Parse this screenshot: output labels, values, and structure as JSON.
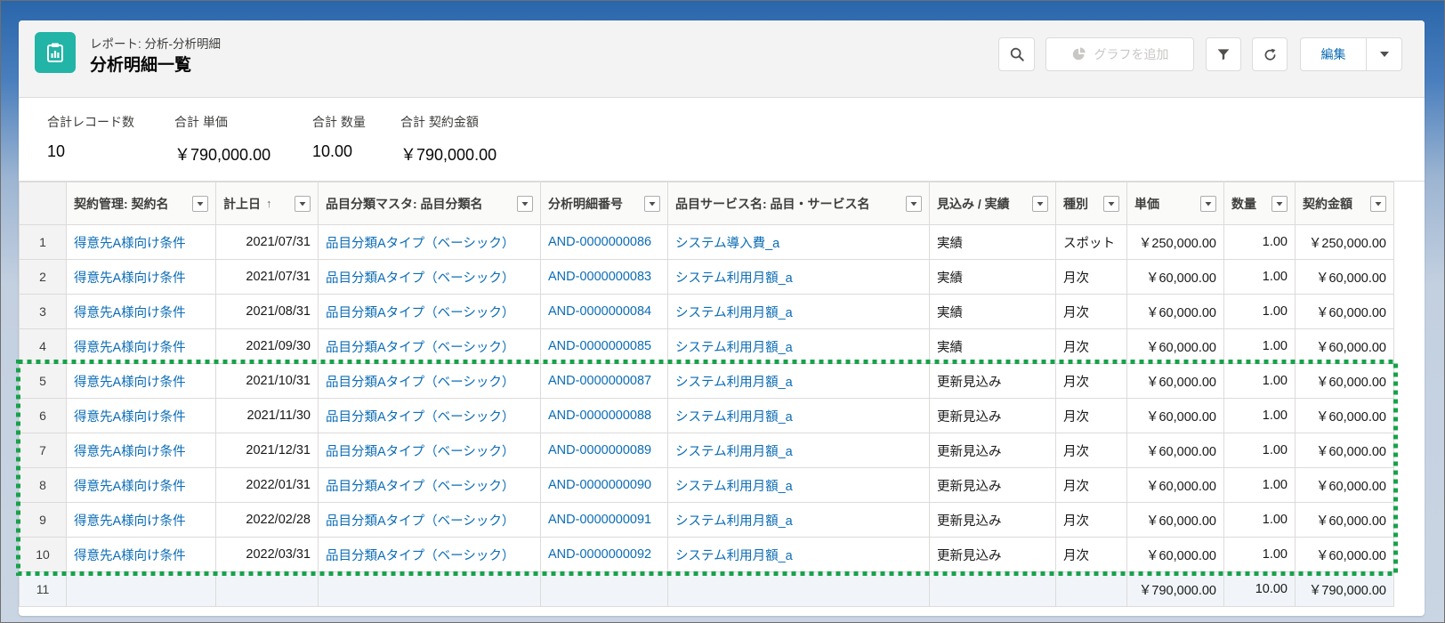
{
  "colors": {
    "accent": "#22b4a6",
    "link": "#0b6cb5",
    "highlight": "#17a24a",
    "page_background": "#2a66ab"
  },
  "report": {
    "icon": "report-icon",
    "subtitle": "レポート: 分析-分析明細",
    "title": "分析明細一覧"
  },
  "toolbar": {
    "search_icon": "search-icon",
    "add_chart_icon": "pie-chart-icon",
    "add_chart_label": "グラフを追加",
    "filter_icon": "filter-icon",
    "refresh_icon": "refresh-icon",
    "edit_label": "編集",
    "edit_menu_icon": "chevron-down-icon"
  },
  "summary": [
    {
      "label": "合計レコード数",
      "value": "10"
    },
    {
      "label": "合計 単価",
      "value": "￥790,000.00"
    },
    {
      "label": "合計 数量",
      "value": "10.00"
    },
    {
      "label": "合計 契約金額",
      "value": "￥790,000.00"
    }
  ],
  "table": {
    "columns": [
      {
        "label": "契約管理: 契約名"
      },
      {
        "label": "計上日",
        "sort": "↑"
      },
      {
        "label": "品目分類マスタ: 品目分類名"
      },
      {
        "label": "分析明細番号"
      },
      {
        "label": "品目サービス名: 品目・サービス名"
      },
      {
        "label": "見込み / 実績"
      },
      {
        "label": "種別"
      },
      {
        "label": "単価"
      },
      {
        "label": "数量"
      },
      {
        "label": "契約金額"
      }
    ],
    "rows": [
      {
        "num": "1",
        "cells": [
          "得意先A様向け条件",
          "2021/07/31",
          "品目分類Aタイプ（ベーシック）",
          "AND-0000000086",
          "システム導入費_a",
          "実績",
          "スポット",
          "￥250,000.00",
          "1.00",
          "￥250,000.00"
        ]
      },
      {
        "num": "2",
        "cells": [
          "得意先A様向け条件",
          "2021/07/31",
          "品目分類Aタイプ（ベーシック）",
          "AND-0000000083",
          "システム利用月額_a",
          "実績",
          "月次",
          "￥60,000.00",
          "1.00",
          "￥60,000.00"
        ]
      },
      {
        "num": "3",
        "cells": [
          "得意先A様向け条件",
          "2021/08/31",
          "品目分類Aタイプ（ベーシック）",
          "AND-0000000084",
          "システム利用月額_a",
          "実績",
          "月次",
          "￥60,000.00",
          "1.00",
          "￥60,000.00"
        ]
      },
      {
        "num": "4",
        "cells": [
          "得意先A様向け条件",
          "2021/09/30",
          "品目分類Aタイプ（ベーシック）",
          "AND-0000000085",
          "システム利用月額_a",
          "実績",
          "月次",
          "￥60,000.00",
          "1.00",
          "￥60,000.00"
        ]
      },
      {
        "num": "5",
        "cells": [
          "得意先A様向け条件",
          "2021/10/31",
          "品目分類Aタイプ（ベーシック）",
          "AND-0000000087",
          "システム利用月額_a",
          "更新見込み",
          "月次",
          "￥60,000.00",
          "1.00",
          "￥60,000.00"
        ]
      },
      {
        "num": "6",
        "cells": [
          "得意先A様向け条件",
          "2021/11/30",
          "品目分類Aタイプ（ベーシック）",
          "AND-0000000088",
          "システム利用月額_a",
          "更新見込み",
          "月次",
          "￥60,000.00",
          "1.00",
          "￥60,000.00"
        ]
      },
      {
        "num": "7",
        "cells": [
          "得意先A様向け条件",
          "2021/12/31",
          "品目分類Aタイプ（ベーシック）",
          "AND-0000000089",
          "システム利用月額_a",
          "更新見込み",
          "月次",
          "￥60,000.00",
          "1.00",
          "￥60,000.00"
        ]
      },
      {
        "num": "8",
        "cells": [
          "得意先A様向け条件",
          "2022/01/31",
          "品目分類Aタイプ（ベーシック）",
          "AND-0000000090",
          "システム利用月額_a",
          "更新見込み",
          "月次",
          "￥60,000.00",
          "1.00",
          "￥60,000.00"
        ]
      },
      {
        "num": "9",
        "cells": [
          "得意先A様向け条件",
          "2022/02/28",
          "品目分類Aタイプ（ベーシック）",
          "AND-0000000091",
          "システム利用月額_a",
          "更新見込み",
          "月次",
          "￥60,000.00",
          "1.00",
          "￥60,000.00"
        ]
      },
      {
        "num": "10",
        "cells": [
          "得意先A様向け条件",
          "2022/03/31",
          "品目分類Aタイプ（ベーシック）",
          "AND-0000000092",
          "システム利用月額_a",
          "更新見込み",
          "月次",
          "￥60,000.00",
          "1.00",
          "￥60,000.00"
        ]
      },
      {
        "num": "11",
        "total": true,
        "cells": [
          "",
          "",
          "",
          "",
          "",
          "",
          "",
          "￥790,000.00",
          "10.00",
          "￥790,000.00"
        ]
      }
    ]
  },
  "highlight": {
    "first_row": 5,
    "last_row": 10,
    "color": "#17a24a"
  }
}
